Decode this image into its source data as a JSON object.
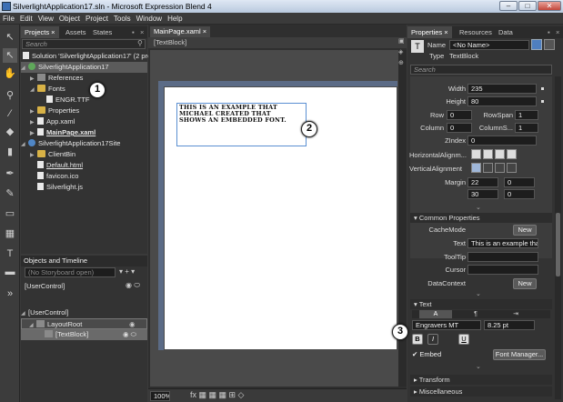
{
  "window": {
    "title": "SilverlightApplication17.sln - Microsoft Expression Blend 4"
  },
  "menu": [
    "File",
    "Edit",
    "View",
    "Object",
    "Project",
    "Tools",
    "Window",
    "Help"
  ],
  "projects_panel": {
    "tabs": [
      "Projects",
      "Assets",
      "States"
    ],
    "search_placeholder": "Search",
    "solution": "Solution 'SilverlightApplication17' (2 pro",
    "project1": "SilverlightApplication17",
    "items": [
      "References",
      "Fonts",
      "ENGR.TTF",
      "Properties",
      "App.xaml",
      "MainPage.xaml"
    ],
    "project2": "SilverlightApplication17Site",
    "items2": [
      "ClientBin",
      "Default.html",
      "favicon.ico",
      "Silverlight.js"
    ]
  },
  "objects_panel": {
    "title": "Objects and Timeline",
    "storyboard": "(No Storyboard open)",
    "usercontrol_header": "[UserControl]",
    "tree": [
      "[UserControl]",
      "LayoutRoot",
      "[TextBlock]"
    ]
  },
  "document": {
    "tab": "MainPage.xaml",
    "breadcrumb": "[TextBlock]",
    "text": "THIS IS AN EXAMPLE THAT MICHAEL CREATED THAT SHOWS AN EMBEDDED FONT.",
    "zoom": "100%"
  },
  "callouts": [
    "1",
    "2",
    "3"
  ],
  "properties": {
    "tabs": [
      "Properties",
      "Resources",
      "Data"
    ],
    "name_label": "Name",
    "name_value": "<No Name>",
    "type_label": "Type",
    "type_value": "TextBlock",
    "search_placeholder": "Search",
    "width_label": "Width",
    "width": "235",
    "height_label": "Height",
    "height": "80",
    "row_label": "Row",
    "row": "0",
    "rowspan_label": "RowSpan",
    "rowspan": "1",
    "column_label": "Column",
    "column": "0",
    "columnspan_label": "ColumnS...",
    "columnspan": "1",
    "zindex_label": "ZIndex",
    "zindex": "0",
    "halign_label": "HorizontalAlignm...",
    "valign_label": "VerticalAlignment",
    "margin_label": "Margin",
    "margin": [
      "22",
      "0",
      "30",
      "0"
    ],
    "common_header": "Common Properties",
    "cachemode_label": "CacheMode",
    "new_label": "New",
    "text_label": "Text",
    "text_value": "This is an example that...",
    "tooltip_label": "ToolTip",
    "cursor_label": "Cursor",
    "datacontext_label": "DataContext",
    "text_header": "Text",
    "font": "Engravers MT",
    "size": "8.25 pt",
    "bold": "B",
    "italic": "I",
    "underline": "U",
    "embed_label": "Embed",
    "font_manager": "Font Manager...",
    "transform_header": "Transform",
    "misc_header": "Miscellaneous"
  }
}
